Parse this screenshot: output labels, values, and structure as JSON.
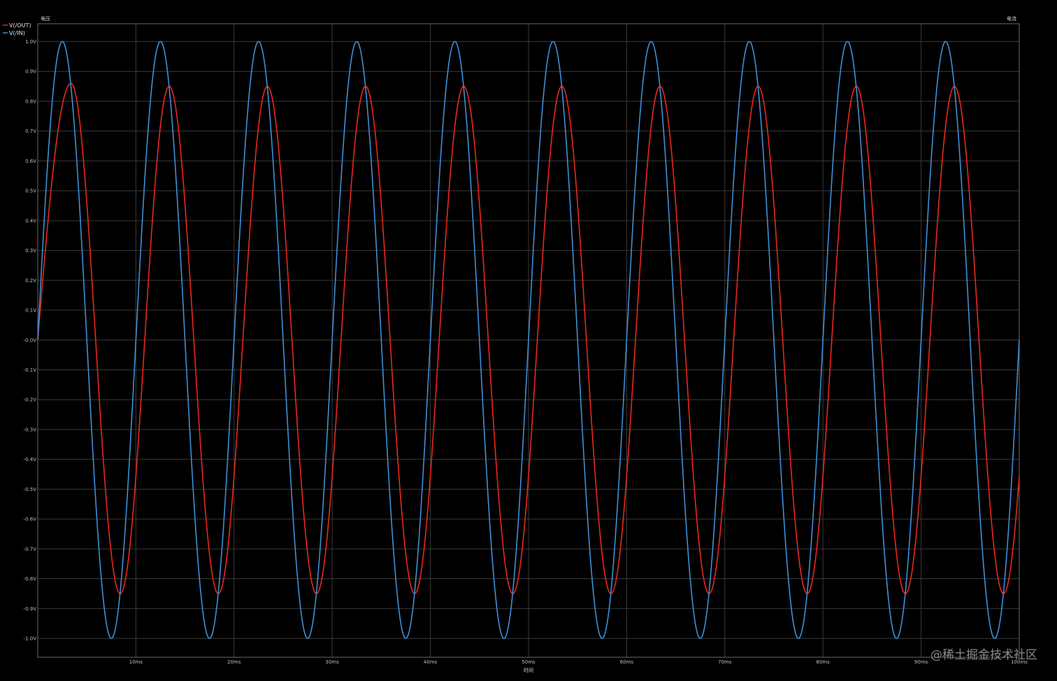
{
  "chart_data": {
    "type": "line",
    "y_axis_title": "电压",
    "y2_axis_title": "电流",
    "x_axis_title": "时间",
    "xlim": [
      0,
      100
    ],
    "ylim": [
      -1.0,
      1.0
    ],
    "x_unit": "ms",
    "grid": true,
    "legend_position": "top-left",
    "x_ticks": [
      {
        "value": 10,
        "label": "10ms"
      },
      {
        "value": 20,
        "label": "20ms"
      },
      {
        "value": 30,
        "label": "30ms"
      },
      {
        "value": 40,
        "label": "40ms"
      },
      {
        "value": 50,
        "label": "50ms"
      },
      {
        "value": 60,
        "label": "60ms"
      },
      {
        "value": 70,
        "label": "70ms"
      },
      {
        "value": 80,
        "label": "80ms"
      },
      {
        "value": 90,
        "label": "90ms"
      },
      {
        "value": 100,
        "label": "100ms"
      }
    ],
    "y_ticks": [
      {
        "value": 1.0,
        "label": "1.0V"
      },
      {
        "value": 0.9,
        "label": "0.9V"
      },
      {
        "value": 0.8,
        "label": "0.8V"
      },
      {
        "value": 0.7,
        "label": "0.7V"
      },
      {
        "value": 0.6,
        "label": "0.6V"
      },
      {
        "value": 0.5,
        "label": "0.5V"
      },
      {
        "value": 0.4,
        "label": "0.4V"
      },
      {
        "value": 0.3,
        "label": "0.3V"
      },
      {
        "value": 0.2,
        "label": "0.2V"
      },
      {
        "value": 0.1,
        "label": "0.1V"
      },
      {
        "value": 0.0,
        "label": "-0.0V"
      },
      {
        "value": -0.1,
        "label": "-0.1V"
      },
      {
        "value": -0.2,
        "label": "-0.2V"
      },
      {
        "value": -0.3,
        "label": "-0.3V"
      },
      {
        "value": -0.4,
        "label": "-0.4V"
      },
      {
        "value": -0.5,
        "label": "-0.5V"
      },
      {
        "value": -0.6,
        "label": "-0.6V"
      },
      {
        "value": -0.7,
        "label": "-0.7V"
      },
      {
        "value": -0.8,
        "label": "-0.8V"
      },
      {
        "value": -0.9,
        "label": "-0.9V"
      },
      {
        "value": -1.0,
        "label": "-1.0V"
      }
    ],
    "series": [
      {
        "name": "V(/OUT)",
        "color": "#e8281e",
        "frequency_hz": 100,
        "amplitude_v": 0.85,
        "first_peak": [
          3.4,
          0.86
        ],
        "steady_state_peaks_v": [
          0.85,
          -0.85
        ],
        "x": [
          0,
          3.4,
          8.4,
          13.4,
          18.4,
          23.4,
          28.4,
          33.4,
          38.4,
          43.4,
          48.4,
          53.4,
          58.4,
          63.4,
          68.4,
          73.4,
          78.4,
          83.4,
          88.4,
          93.4,
          98.4,
          100
        ],
        "y": [
          0.0,
          0.86,
          -0.85,
          0.85,
          -0.85,
          0.85,
          -0.85,
          0.85,
          -0.85,
          0.85,
          -0.85,
          0.85,
          -0.85,
          0.85,
          -0.85,
          0.85,
          -0.85,
          0.85,
          -0.85,
          0.85,
          -0.85,
          -0.45
        ]
      },
      {
        "name": "V(/IN)",
        "color": "#3f8fd6",
        "frequency_hz": 100,
        "amplitude_v": 1.0,
        "x": [
          0,
          2.5,
          7.5,
          12.5,
          17.5,
          22.5,
          27.5,
          32.5,
          37.5,
          42.5,
          47.5,
          52.5,
          57.5,
          62.5,
          67.5,
          72.5,
          77.5,
          82.5,
          87.5,
          92.5,
          97.5,
          100
        ],
        "y": [
          0.0,
          1.0,
          -1.0,
          1.0,
          -1.0,
          1.0,
          -1.0,
          1.0,
          -1.0,
          1.0,
          -1.0,
          1.0,
          -1.0,
          1.0,
          -1.0,
          1.0,
          -1.0,
          1.0,
          -1.0,
          1.0,
          -1.0,
          0.0
        ]
      }
    ]
  },
  "watermark": "@稀土掘金技术社区"
}
